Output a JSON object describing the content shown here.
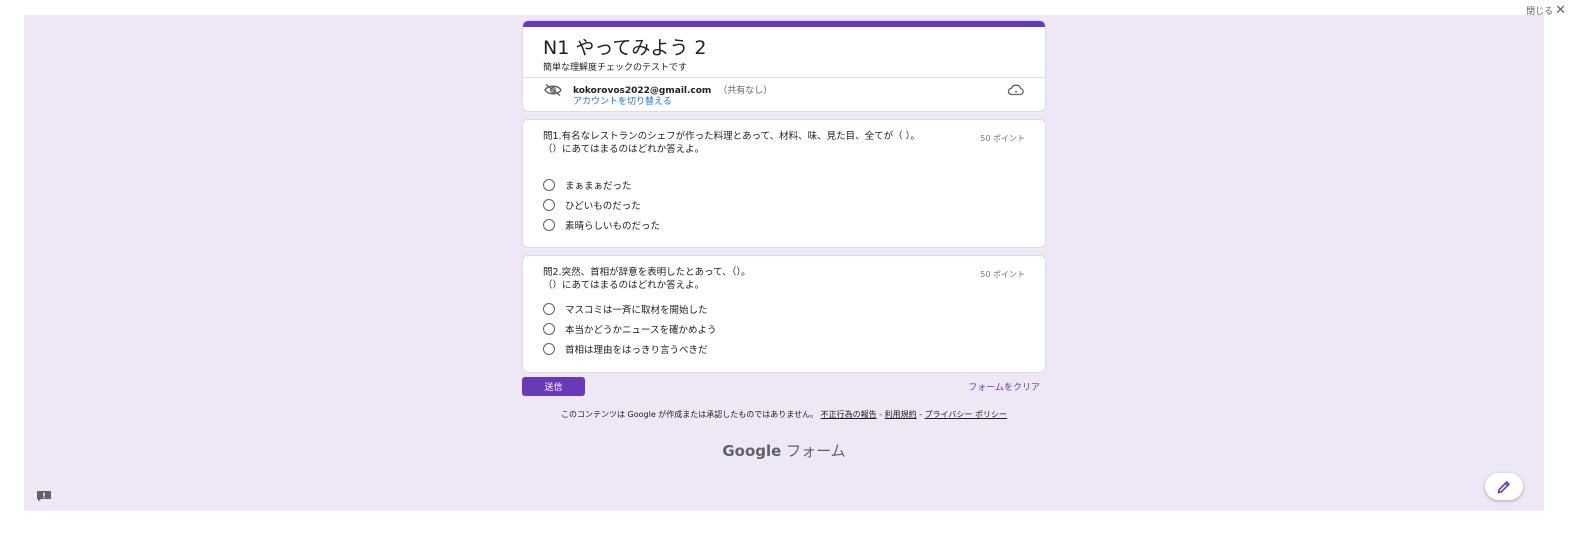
{
  "window": {
    "close_label": "閉じる",
    "close_icon": "close-icon"
  },
  "colors": {
    "accent": "#673ab7",
    "background": "#ede7f6",
    "link": "#1a73e8"
  },
  "header": {
    "title": "N1 やってみよう 2",
    "description": "簡単な理解度チェックのテストです",
    "account_email": "kokorovos2022@gmail.com",
    "share_status": "（共有なし）",
    "switch_account": "アカウントを切り替える",
    "icons": [
      "eye-off-icon",
      "cloud-icon"
    ]
  },
  "questions": [
    {
      "line1": "問1.有名なレストランのシェフが作った料理とあって、材料、味、見た目、全てが（ ）。",
      "line2": "（）にあてはまるのはどれか答えよ。",
      "points": "50 ポイント",
      "options": [
        "まぁまぁだった",
        "ひどいものだった",
        "素晴らしいものだった"
      ]
    },
    {
      "line1": "問2.突然、首相が辞意を表明したとあって、（）。",
      "line2": "（）にあてはまるのはどれか答えよ。",
      "points": "50 ポイント",
      "options": [
        "マスコミは一斉に取材を開始した",
        "本当かどうかニュースを確かめよう",
        "首相は理由をはっきり言うべきだ"
      ]
    }
  ],
  "actions": {
    "submit": "送信",
    "clear": "フォームをクリア"
  },
  "footer": {
    "disclaimer": "このコンテンツは Google が作成または承認したものではありません。",
    "report_abuse": "不正行為の報告",
    "sep1": " - ",
    "terms": "利用規約",
    "sep2": " - ",
    "privacy": "プライバシー ポリシー"
  },
  "brand": {
    "google": "Google",
    "forms": "フォーム"
  },
  "fab": {
    "icon": "pencil-icon"
  },
  "feedback": {
    "icon": "feedback-icon"
  }
}
